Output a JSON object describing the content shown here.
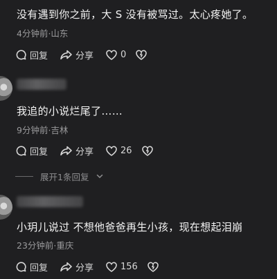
{
  "comments": [
    {
      "text": "没有遇到你之前，大 S 没有被骂过。太心疼她了。",
      "meta": "4分钟前·山东",
      "reply_label": "回复",
      "share_label": "分享",
      "like_count": "0"
    },
    {
      "text": "我追的小说烂尾了……",
      "meta": "9分钟前·吉林",
      "reply_label": "回复",
      "share_label": "分享",
      "like_count": "26"
    },
    {
      "text": "小玥儿说过 不想他爸爸再生小孩，现在想起泪崩",
      "meta": "23分钟前·重庆",
      "reply_label": "回复",
      "share_label": "分享",
      "like_count": "156"
    }
  ],
  "expand_replies": "展开1条回复",
  "icons": [
    "reply-icon",
    "share-icon",
    "like-icon",
    "dislike-icon",
    "chevron-down-icon"
  ],
  "colors": {
    "background": "#1f1f21",
    "text": "#f4f4f4",
    "meta": "#9a9a9c"
  }
}
